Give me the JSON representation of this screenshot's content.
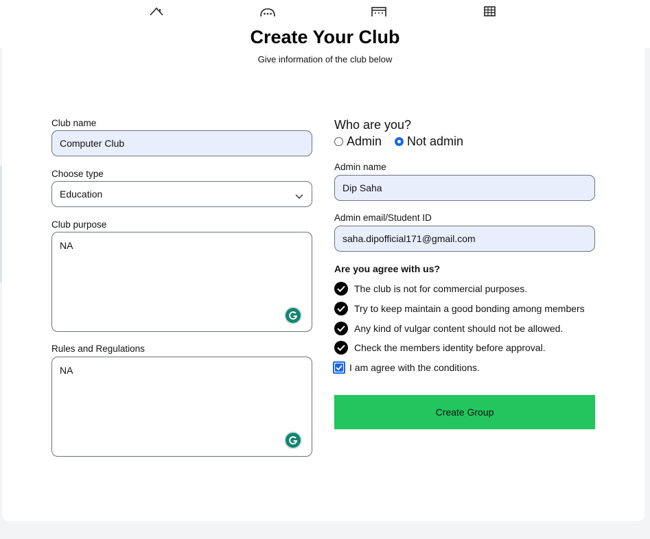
{
  "header": {
    "nav_icons": [
      "home-icon",
      "chat-icon",
      "calendar-icon",
      "grid-icon"
    ],
    "title": "Create Your Club",
    "subtitle": "Give information of the club below"
  },
  "form_left": {
    "club_name": {
      "label": "Club name",
      "value": "Computer Club"
    },
    "club_type": {
      "label": "Choose type",
      "value": "Education"
    },
    "club_purpose": {
      "label": "Club purpose",
      "value": "NA"
    },
    "rules": {
      "label": "Rules and Regulations",
      "value": "NA"
    }
  },
  "form_right": {
    "who_label": "Who are you?",
    "role_options": [
      {
        "label": "Admin",
        "selected": false
      },
      {
        "label": "Not admin",
        "selected": true
      }
    ],
    "admin_name": {
      "label": "Admin name",
      "value": "Dip Saha"
    },
    "admin_email": {
      "label": "Admin email/Student ID",
      "value": "saha.dipofficial171@gmail.com"
    },
    "agree_title": "Are you agree with us?",
    "conditions": [
      "The club is not for commercial purposes.",
      "Try to keep maintain a good bonding among members",
      "Any kind of vulgar content should not be allowed.",
      "Check the members identity before approval."
    ],
    "agree_checkbox": {
      "label": "I am agree with the conditions.",
      "checked": true
    },
    "submit_label": "Create Group"
  },
  "colors": {
    "accent": "#1a66e8",
    "button_green": "#22c55e",
    "field_fill": "#e8eefc",
    "grammarly": "#15846f"
  }
}
